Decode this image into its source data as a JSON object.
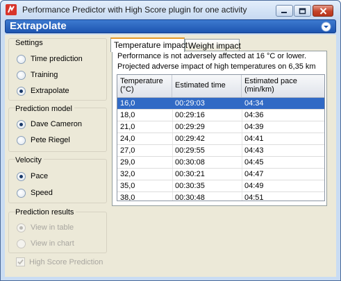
{
  "window": {
    "title": "Performance Predictor with High Score plugin for one activity"
  },
  "banner": {
    "title": "Extrapolate",
    "chevron_icon": "chevron-down-circle-icon"
  },
  "settings": {
    "group_title": "Settings",
    "options": [
      {
        "label": "Time prediction",
        "checked": false
      },
      {
        "label": "Training",
        "checked": false
      },
      {
        "label": "Extrapolate",
        "checked": true
      }
    ]
  },
  "prediction_model": {
    "group_title": "Prediction model",
    "options": [
      {
        "label": "Dave Cameron",
        "checked": true
      },
      {
        "label": "Pete Riegel",
        "checked": false
      }
    ]
  },
  "velocity": {
    "group_title": "Velocity",
    "options": [
      {
        "label": "Pace",
        "checked": true
      },
      {
        "label": "Speed",
        "checked": false
      }
    ]
  },
  "prediction_results": {
    "group_title": "Prediction results",
    "options": [
      {
        "label": "View in table",
        "checked": true
      },
      {
        "label": "View in chart",
        "checked": false
      }
    ]
  },
  "high_score": {
    "label": "High Score Prediction",
    "checked": true
  },
  "tabs": [
    {
      "label": "Temperature impact",
      "active": true
    },
    {
      "label": "Weight impact",
      "active": false
    }
  ],
  "info": {
    "line1": "Performance is not adversely affected at 16 °C or lower.",
    "line2": "Projected adverse impact of high temperatures on 6,35 km"
  },
  "table": {
    "headers": {
      "temperature_line1": "Temperature",
      "temperature_line2": "(°C)",
      "time": "Estimated time",
      "pace_line1": "Estimated pace",
      "pace_line2": "(min/km)"
    },
    "rows": [
      {
        "temp": "16,0",
        "time": "00:29:03",
        "pace": "04:34",
        "selected": true
      },
      {
        "temp": "18,0",
        "time": "00:29:16",
        "pace": "04:36",
        "selected": false
      },
      {
        "temp": "21,0",
        "time": "00:29:29",
        "pace": "04:39",
        "selected": false
      },
      {
        "temp": "24,0",
        "time": "00:29:42",
        "pace": "04:41",
        "selected": false
      },
      {
        "temp": "27,0",
        "time": "00:29:55",
        "pace": "04:43",
        "selected": false
      },
      {
        "temp": "29,0",
        "time": "00:30:08",
        "pace": "04:45",
        "selected": false
      },
      {
        "temp": "32,0",
        "time": "00:30:21",
        "pace": "04:47",
        "selected": false
      },
      {
        "temp": "35,0",
        "time": "00:30:35",
        "pace": "04:49",
        "selected": false
      },
      {
        "temp": "38,0",
        "time": "00:30:48",
        "pace": "04:51",
        "selected": false
      }
    ]
  },
  "colors": {
    "banner": "#1d55b0",
    "selection": "#316ac5",
    "tab_accent": "#e69a2a",
    "close_button": "#c4442a"
  }
}
